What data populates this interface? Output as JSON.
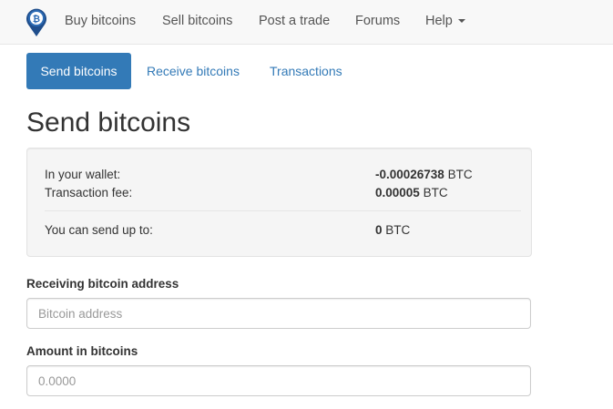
{
  "navbar": {
    "items": [
      {
        "label": "Buy bitcoins"
      },
      {
        "label": "Sell bitcoins"
      },
      {
        "label": "Post a trade"
      },
      {
        "label": "Forums"
      },
      {
        "label": "Help"
      }
    ]
  },
  "tabs": [
    {
      "label": "Send bitcoins",
      "active": true
    },
    {
      "label": "Receive bitcoins"
    },
    {
      "label": "Transactions"
    }
  ],
  "page_title": "Send bitcoins",
  "wallet": {
    "wallet_label": "In your wallet:",
    "wallet_amount": "-0.00026738",
    "fee_label": "Transaction fee:",
    "fee_amount": "0.00005",
    "send_label": "You can send up to:",
    "send_amount": "0",
    "unit": "BTC"
  },
  "form": {
    "address_label": "Receiving bitcoin address",
    "address_placeholder": "Bitcoin address",
    "amount_label": "Amount in bitcoins",
    "amount_placeholder": "0.0000"
  },
  "colors": {
    "primary": "#337ab7",
    "navbar_bg": "#f8f8f8",
    "well_bg": "#f5f5f5"
  },
  "icons": {
    "logo": "bitcoin-map-pin-logo",
    "help_dropdown": "caret-down-icon"
  }
}
